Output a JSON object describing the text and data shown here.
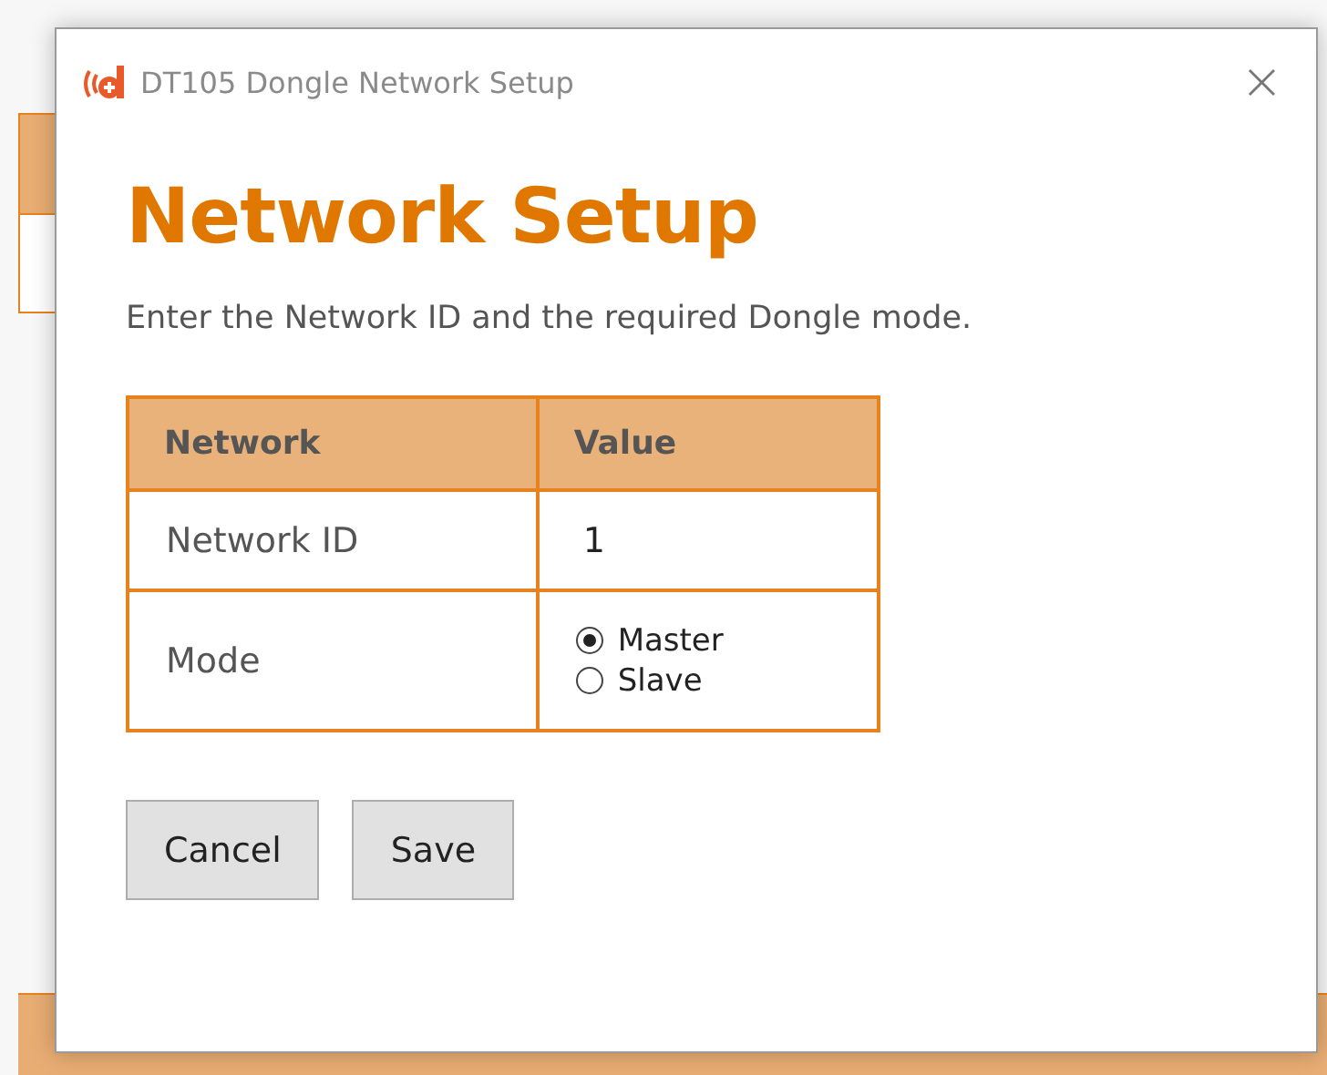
{
  "dialog": {
    "title": "DT105 Dongle Network Setup",
    "close": "×"
  },
  "heading": "Network Setup",
  "description": "Enter the Network ID and the required Dongle mode.",
  "table": {
    "columns": [
      "Network",
      "Value"
    ],
    "rows": [
      {
        "kind": "text",
        "label": "Network ID",
        "value": "1"
      },
      {
        "kind": "radio",
        "label": "Mode",
        "options": [
          {
            "label": "Master",
            "selected": true
          },
          {
            "label": "Slave",
            "selected": false
          }
        ]
      }
    ]
  },
  "buttons": [
    "Cancel",
    "Save"
  ]
}
